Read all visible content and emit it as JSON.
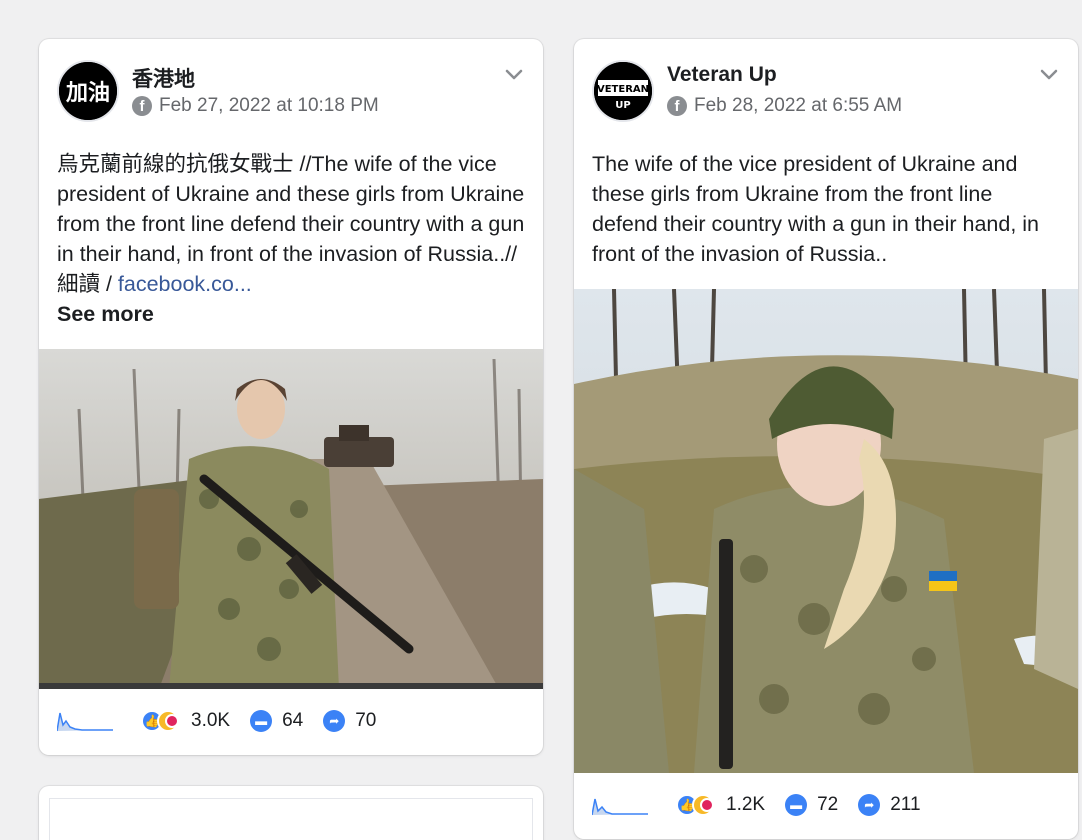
{
  "posts": [
    {
      "author": "香港地",
      "timestamp": "Feb 27, 2022 at 10:18 PM",
      "text": "烏克蘭前線的抗俄女戰士 //The wife of the vice president of Ukraine and these girls from Ukraine from the front line defend their country with a gun in their hand, in front of the invasion of Russia..// 細讀 / ",
      "link_text": "facebook.co...",
      "see_more": "See more",
      "reactions": "3.0K",
      "comments": "64",
      "shares": "70"
    },
    {
      "author": "Veteran Up",
      "timestamp": "Feb 28, 2022 at 6:55 AM",
      "text": "The wife of the vice president of Ukraine and these girls from Ukraine from the front line defend their country with a gun in their hand, in front of the invasion of Russia..",
      "reactions": "1.2K",
      "comments": "72",
      "shares": "211"
    }
  ],
  "avatars": {
    "left_text": "加油",
    "right_line1": "VETERAN",
    "right_line2": "UP"
  },
  "colors": {
    "accent": "#3b82f6",
    "link": "#385898",
    "meta": "#65676b"
  }
}
